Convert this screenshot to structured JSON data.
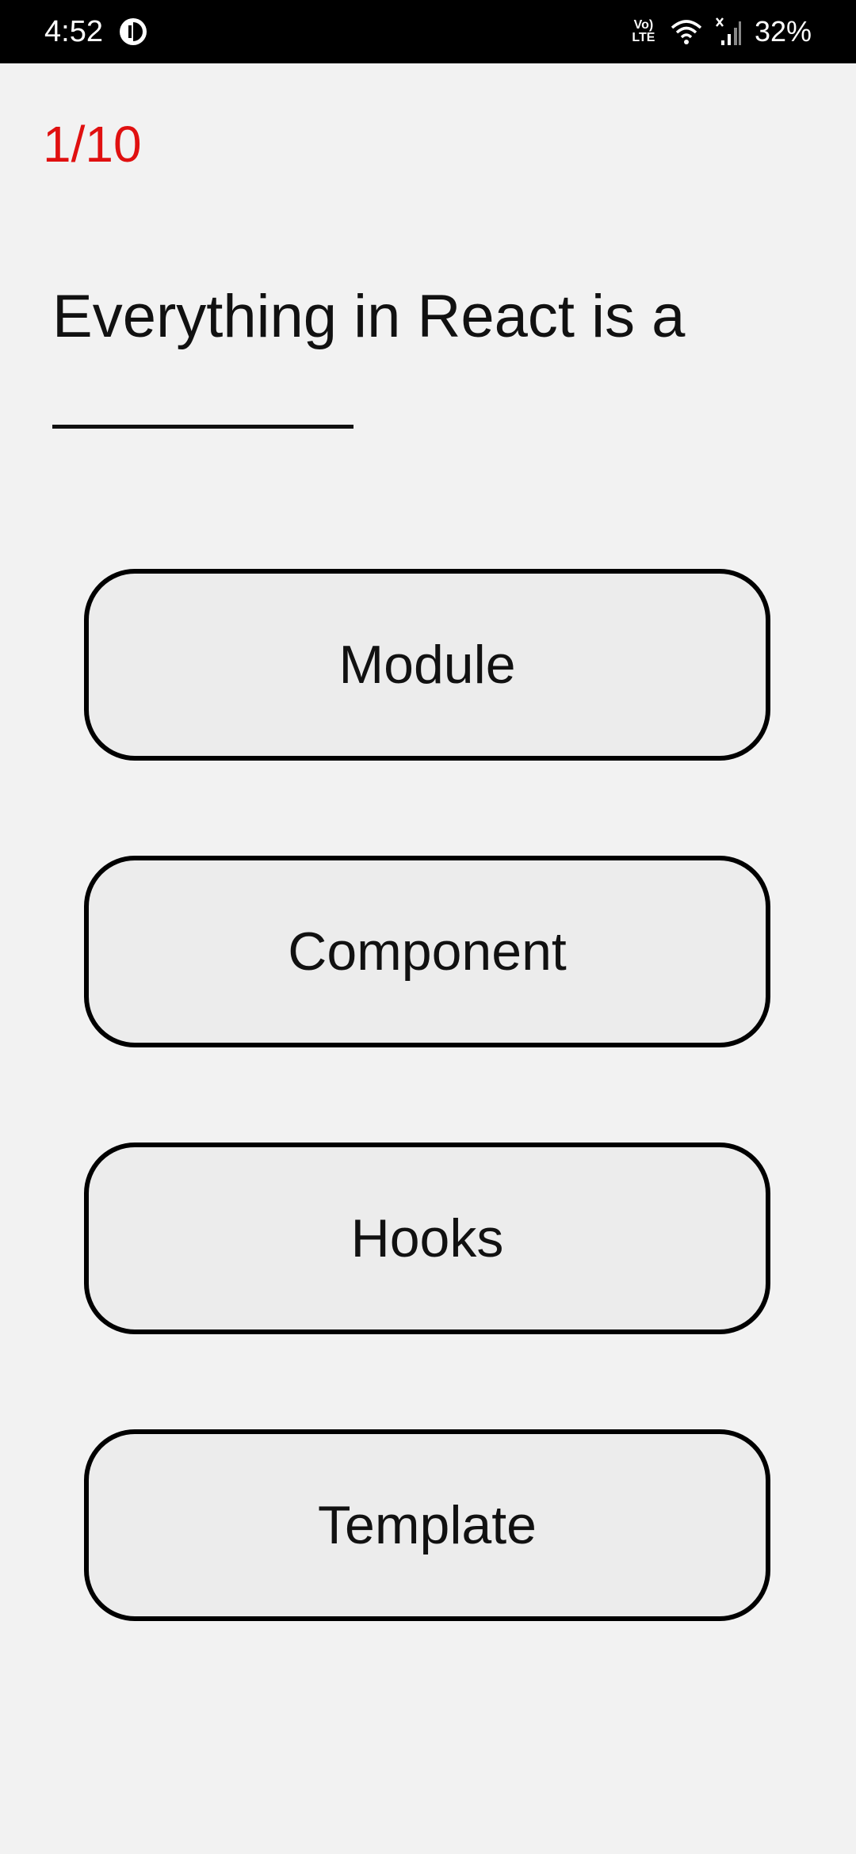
{
  "status_bar": {
    "time": "4:52",
    "network_label": "Vo) LTE",
    "battery": "32%",
    "icons": [
      "app-notification-icon",
      "volte-icon",
      "wifi-icon",
      "cell-signal-icon"
    ]
  },
  "quiz": {
    "counter": "1/10",
    "question": "Everything in React is a",
    "options": [
      "Module",
      "Component",
      "Hooks",
      "Template"
    ]
  },
  "colors": {
    "counter": "#e01010",
    "background": "#f2f2f2",
    "option_fill": "#ececec",
    "option_border": "#000000"
  }
}
